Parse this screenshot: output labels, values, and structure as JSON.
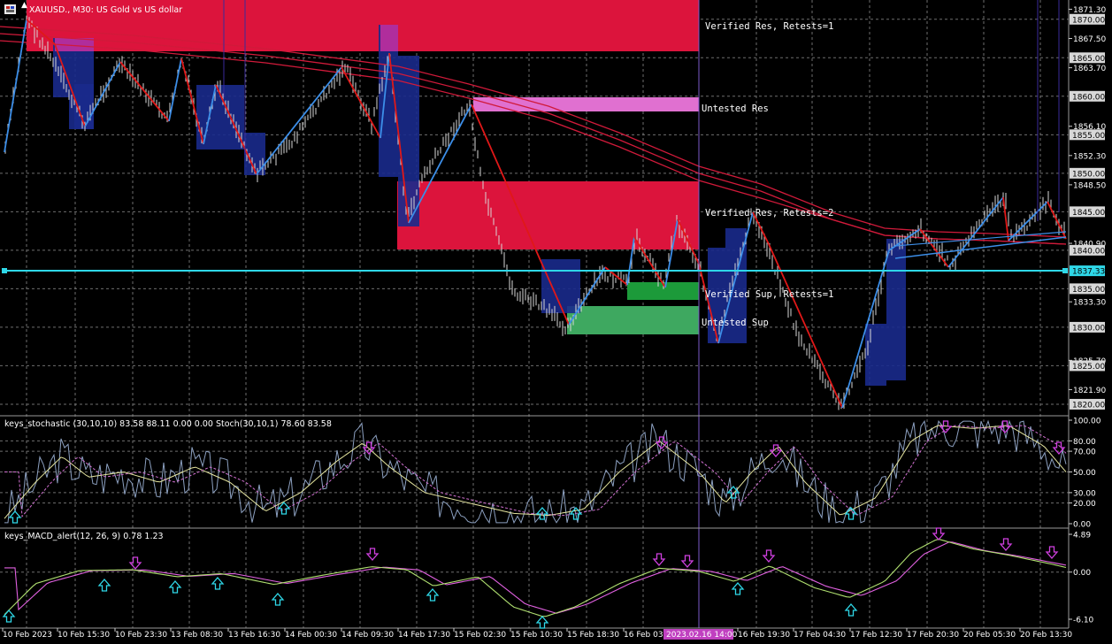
{
  "header": {
    "menu_icon": "menu-grid-icon",
    "symbol_text": "XAUUSD., M30: US Gold vs US dollar"
  },
  "colors": {
    "background": "#000000",
    "grid": "#8a8a8a",
    "resistance_zone": "#dc143c",
    "resistance_zone_light": "#e070d0",
    "support_zone_dark": "#1c9a3a",
    "support_zone_light": "#3ea860",
    "volume_box": "#1a2a8c",
    "zigzag_up": "#3c8ee8",
    "zigzag_down": "#e01818",
    "moving_average": "#d01a3a",
    "current_price_line": "#2fd8e8",
    "price_bars": "#d8d8d8",
    "stoch_main": "#8ca0c0",
    "stoch_signal": "#e6e6a0",
    "macd_main": "#b0e070",
    "macd_signal": "#e060e0",
    "up_arrow": "#2fd8e8",
    "down_arrow": "#d040e0",
    "time_highlight": "#c040c0"
  },
  "zones": [
    {
      "label": "Verified Res, Retests=1",
      "kind": "resistance"
    },
    {
      "label": "Untested Res",
      "kind": "resistance_light"
    },
    {
      "label": "Verified Res, Retests=2",
      "kind": "resistance"
    },
    {
      "label": "Verified Sup, Retests=1",
      "kind": "support"
    },
    {
      "label": "Untested Sup",
      "kind": "support_light"
    }
  ],
  "current_price": "1837.33",
  "price_axis_labels": [
    "1871.30",
    "1870.00",
    "1867.50",
    "1865.00",
    "1863.70",
    "1860.00",
    "1856.10",
    "1855.00",
    "1852.30",
    "1850.00",
    "1848.50",
    "1845.00",
    "1840.90",
    "1840.00",
    "1837.33",
    "1835.00",
    "1833.30",
    "1830.00",
    "1825.70",
    "1825.00",
    "1821.90",
    "1820.00"
  ],
  "stoch_panel": {
    "title": "keys_stochastic (30,10,10) 83.58 88.11 0.00 0.00 Stoch(30,10,1) 78.60 83.58",
    "axis_labels": [
      "100.00",
      "80.00",
      "70.00",
      "50.00",
      "30.00",
      "20.00",
      "0.00"
    ]
  },
  "macd_panel": {
    "title": "keys_MACD_alert(12, 26, 9) 0.78 1.23",
    "axis_labels": [
      "4.89",
      "0.00",
      "-6.10"
    ]
  },
  "time_axis": {
    "labels": [
      "10 Feb 2023",
      "10 Feb 15:30",
      "10 Feb 23:30",
      "13 Feb 08:30",
      "13 Feb 16:30",
      "14 Feb 00:30",
      "14 Feb 09:30",
      "14 Feb 17:30",
      "15 Feb 02:30",
      "15 Feb 10:30",
      "15 Feb 18:30",
      "16 Feb 03:30",
      "16 Feb 19:30",
      "17 Feb 04:30",
      "17 Feb 12:30",
      "17 Feb 20:30",
      "20 Feb 05:30",
      "20 Feb 13:30"
    ],
    "crosshair_label": "2023.02.16 14:00"
  },
  "price_scale": {
    "min": 1818.5,
    "max": 1872.5
  },
  "stoch_scale": {
    "min": 0,
    "max": 100
  },
  "macd_scale": {
    "min": -6.1,
    "max": 4.89
  }
}
